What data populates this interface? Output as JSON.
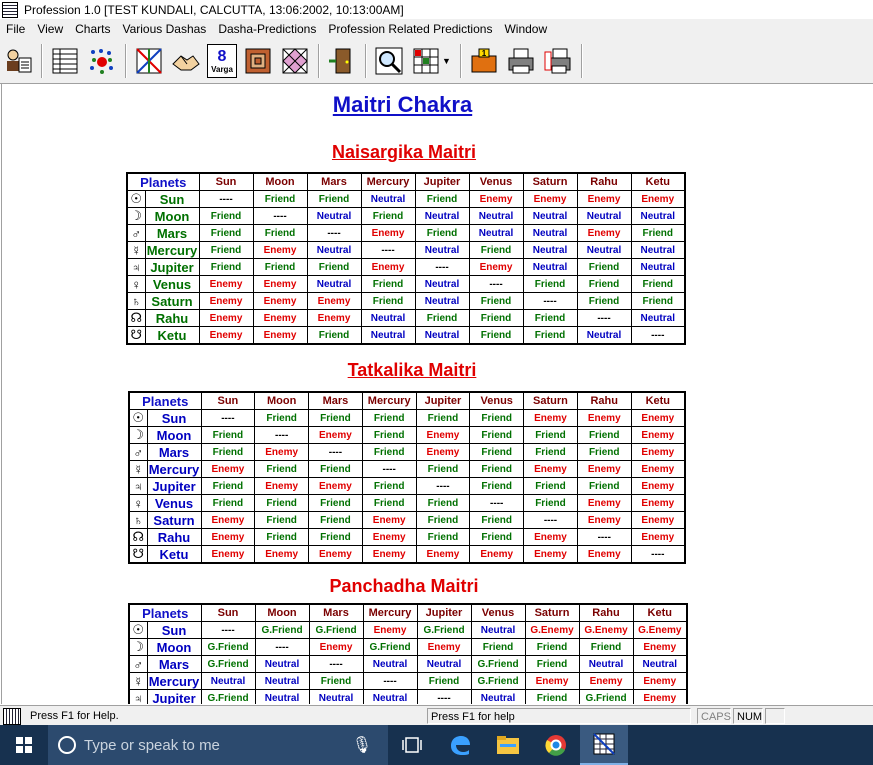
{
  "window": {
    "title": "Profession 1.0 [TEST KUNDALI, CALCUTTA, 13:06:2002, 10:13:00AM]"
  },
  "menu": [
    "File",
    "View",
    "Charts",
    "Various Dashas",
    "Dasha-Predictions",
    "Profession Related Predictions",
    "Window"
  ],
  "toolbar": {
    "varga_label": "8",
    "varga_sub": "Varga"
  },
  "page": {
    "title": "Maitri Chakra"
  },
  "planet_symbols": [
    "☉",
    "☽",
    "♂",
    "☿",
    "♃",
    "♀",
    "♄",
    "☊",
    "☋"
  ],
  "tables": [
    {
      "title": "Naisargika Maitri",
      "planets_header": "Planets",
      "columns": [
        "Sun",
        "Moon",
        "Mars",
        "Mercury",
        "Jupiter",
        "Venus",
        "Saturn",
        "Rahu",
        "Ketu"
      ],
      "rows": [
        {
          "planet": "Sun",
          "cells": [
            "----",
            "Friend",
            "Friend",
            "Neutral",
            "Friend",
            "Enemy",
            "Enemy",
            "Enemy",
            "Enemy"
          ]
        },
        {
          "planet": "Moon",
          "cells": [
            "Friend",
            "----",
            "Neutral",
            "Friend",
            "Neutral",
            "Neutral",
            "Neutral",
            "Neutral",
            "Neutral"
          ]
        },
        {
          "planet": "Mars",
          "cells": [
            "Friend",
            "Friend",
            "----",
            "Enemy",
            "Friend",
            "Neutral",
            "Neutral",
            "Enemy",
            "Friend"
          ]
        },
        {
          "planet": "Mercury",
          "cells": [
            "Friend",
            "Enemy",
            "Neutral",
            "----",
            "Neutral",
            "Friend",
            "Neutral",
            "Neutral",
            "Neutral"
          ]
        },
        {
          "planet": "Jupiter",
          "cells": [
            "Friend",
            "Friend",
            "Friend",
            "Enemy",
            "----",
            "Enemy",
            "Neutral",
            "Friend",
            "Neutral"
          ]
        },
        {
          "planet": "Venus",
          "cells": [
            "Enemy",
            "Enemy",
            "Neutral",
            "Friend",
            "Neutral",
            "----",
            "Friend",
            "Friend",
            "Friend"
          ]
        },
        {
          "planet": "Saturn",
          "cells": [
            "Enemy",
            "Enemy",
            "Enemy",
            "Friend",
            "Neutral",
            "Friend",
            "----",
            "Friend",
            "Friend"
          ]
        },
        {
          "planet": "Rahu",
          "cells": [
            "Enemy",
            "Enemy",
            "Enemy",
            "Neutral",
            "Friend",
            "Friend",
            "Friend",
            "----",
            "Neutral"
          ]
        },
        {
          "planet": "Ketu",
          "cells": [
            "Enemy",
            "Enemy",
            "Friend",
            "Neutral",
            "Neutral",
            "Friend",
            "Friend",
            "Neutral",
            "----"
          ]
        }
      ]
    },
    {
      "title": "Tatkalika Maitri",
      "planets_header": "Planets",
      "columns": [
        "Sun",
        "Moon",
        "Mars",
        "Mercury",
        "Jupiter",
        "Venus",
        "Saturn",
        "Rahu",
        "Ketu"
      ],
      "rows": [
        {
          "planet": "Sun",
          "cells": [
            "----",
            "Friend",
            "Friend",
            "Friend",
            "Friend",
            "Friend",
            "Enemy",
            "Enemy",
            "Enemy"
          ]
        },
        {
          "planet": "Moon",
          "cells": [
            "Friend",
            "----",
            "Enemy",
            "Friend",
            "Enemy",
            "Friend",
            "Friend",
            "Friend",
            "Enemy"
          ]
        },
        {
          "planet": "Mars",
          "cells": [
            "Friend",
            "Enemy",
            "----",
            "Friend",
            "Enemy",
            "Friend",
            "Friend",
            "Friend",
            "Enemy"
          ]
        },
        {
          "planet": "Mercury",
          "cells": [
            "Enemy",
            "Friend",
            "Friend",
            "----",
            "Friend",
            "Friend",
            "Enemy",
            "Enemy",
            "Enemy"
          ]
        },
        {
          "planet": "Jupiter",
          "cells": [
            "Friend",
            "Enemy",
            "Enemy",
            "Friend",
            "----",
            "Friend",
            "Friend",
            "Friend",
            "Enemy"
          ]
        },
        {
          "planet": "Venus",
          "cells": [
            "Friend",
            "Friend",
            "Friend",
            "Friend",
            "Friend",
            "----",
            "Friend",
            "Enemy",
            "Enemy"
          ]
        },
        {
          "planet": "Saturn",
          "cells": [
            "Enemy",
            "Friend",
            "Friend",
            "Enemy",
            "Friend",
            "Friend",
            "----",
            "Enemy",
            "Enemy"
          ]
        },
        {
          "planet": "Rahu",
          "cells": [
            "Enemy",
            "Friend",
            "Friend",
            "Enemy",
            "Friend",
            "Friend",
            "Enemy",
            "----",
            "Enemy"
          ]
        },
        {
          "planet": "Ketu",
          "cells": [
            "Enemy",
            "Enemy",
            "Enemy",
            "Enemy",
            "Enemy",
            "Enemy",
            "Enemy",
            "Enemy",
            "----"
          ]
        }
      ]
    },
    {
      "title": "Panchadha Maitri",
      "planets_header": "Planets",
      "columns": [
        "Sun",
        "Moon",
        "Mars",
        "Mercury",
        "Jupiter",
        "Venus",
        "Saturn",
        "Rahu",
        "Ketu"
      ],
      "rows": [
        {
          "planet": "Sun",
          "cells": [
            "----",
            "G.Friend",
            "G.Friend",
            "Enemy",
            "G.Friend",
            "Neutral",
            "G.Enemy",
            "G.Enemy",
            "G.Enemy"
          ]
        },
        {
          "planet": "Moon",
          "cells": [
            "G.Friend",
            "----",
            "Enemy",
            "G.Friend",
            "Enemy",
            "Friend",
            "Friend",
            "Friend",
            "Enemy"
          ]
        },
        {
          "planet": "Mars",
          "cells": [
            "G.Friend",
            "Neutral",
            "----",
            "Neutral",
            "Neutral",
            "G.Friend",
            "Friend",
            "Neutral",
            "Neutral"
          ]
        },
        {
          "planet": "Mercury",
          "cells": [
            "Neutral",
            "Neutral",
            "Friend",
            "----",
            "Friend",
            "G.Friend",
            "Enemy",
            "Enemy",
            "Enemy"
          ]
        },
        {
          "planet": "Jupiter",
          "cells": [
            "G.Friend",
            "Neutral",
            "Neutral",
            "Neutral",
            "----",
            "Neutral",
            "Friend",
            "G.Friend",
            "Enemy"
          ]
        }
      ]
    }
  ],
  "status": {
    "left": "Press F1 for Help.",
    "middle": "Press F1 for help",
    "caps": "CAPS",
    "num": "NUM"
  },
  "taskbar": {
    "search_placeholder": "Type or speak to me"
  }
}
